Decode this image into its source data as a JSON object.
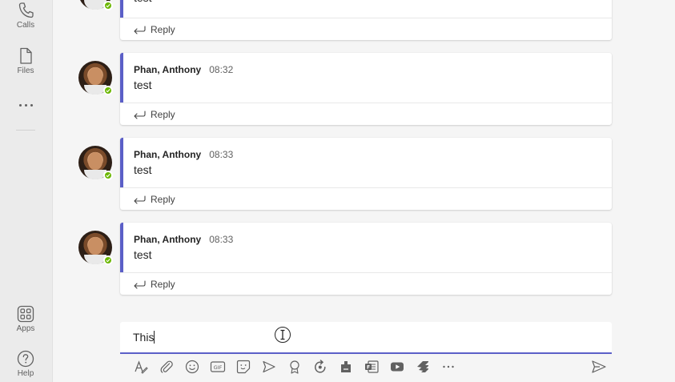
{
  "app_bar": {
    "items": [
      {
        "label": "Calls",
        "icon": "phone-icon"
      },
      {
        "label": "Files",
        "icon": "file-icon"
      },
      {
        "label": "Apps",
        "icon": "apps-icon"
      },
      {
        "label": "Help",
        "icon": "help-icon"
      }
    ],
    "more_icon": "more-horizontal-icon"
  },
  "messages": [
    {
      "author": "",
      "time": "",
      "text": "test",
      "reply_label": "Reply"
    },
    {
      "author": "Phan, Anthony",
      "time": "08:32",
      "text": "test",
      "reply_label": "Reply"
    },
    {
      "author": "Phan, Anthony",
      "time": "08:33",
      "text": "test",
      "reply_label": "Reply"
    },
    {
      "author": "Phan, Anthony",
      "time": "08:33",
      "text": "test",
      "reply_label": "Reply"
    }
  ],
  "compose": {
    "value": "This"
  },
  "toolbar": {
    "tools": [
      "format-icon",
      "attach-icon",
      "emoji-icon",
      "gif-icon",
      "sticker-icon",
      "meet-now-icon",
      "praise-icon",
      "loop-icon",
      "approvals-icon",
      "forms-icon",
      "stream-icon",
      "jira-icon",
      "more-options-icon"
    ],
    "send_icon": "send-icon"
  },
  "colors": {
    "accent": "#5b5fc7",
    "presence_available": "#6bb700",
    "app_bar_bg": "#ebebeb",
    "canvas_bg": "#f5f5f5"
  }
}
